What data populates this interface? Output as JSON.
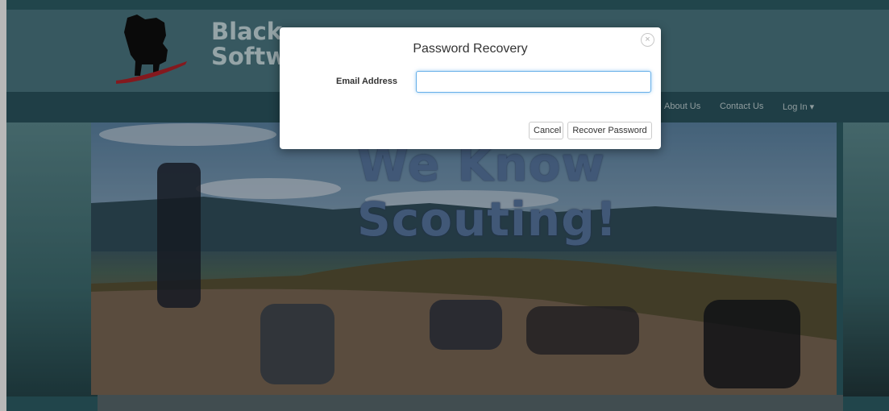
{
  "brand": {
    "line1": "Black",
    "line2": "Softw"
  },
  "nav": {
    "about": "About Us",
    "contact": "Contact Us",
    "login": "Log In",
    "login_caret": "▾"
  },
  "hero": {
    "title": "We Know Scouting!"
  },
  "modal": {
    "title": "Password Recovery",
    "close_glyph": "×",
    "email_label": "Email Address",
    "email_value": "",
    "cancel_label": "Cancel",
    "recover_label": "Recover Password"
  },
  "colors": {
    "header": "#4d7a86",
    "nav": "#2c5761",
    "focus": "#66afe9"
  }
}
